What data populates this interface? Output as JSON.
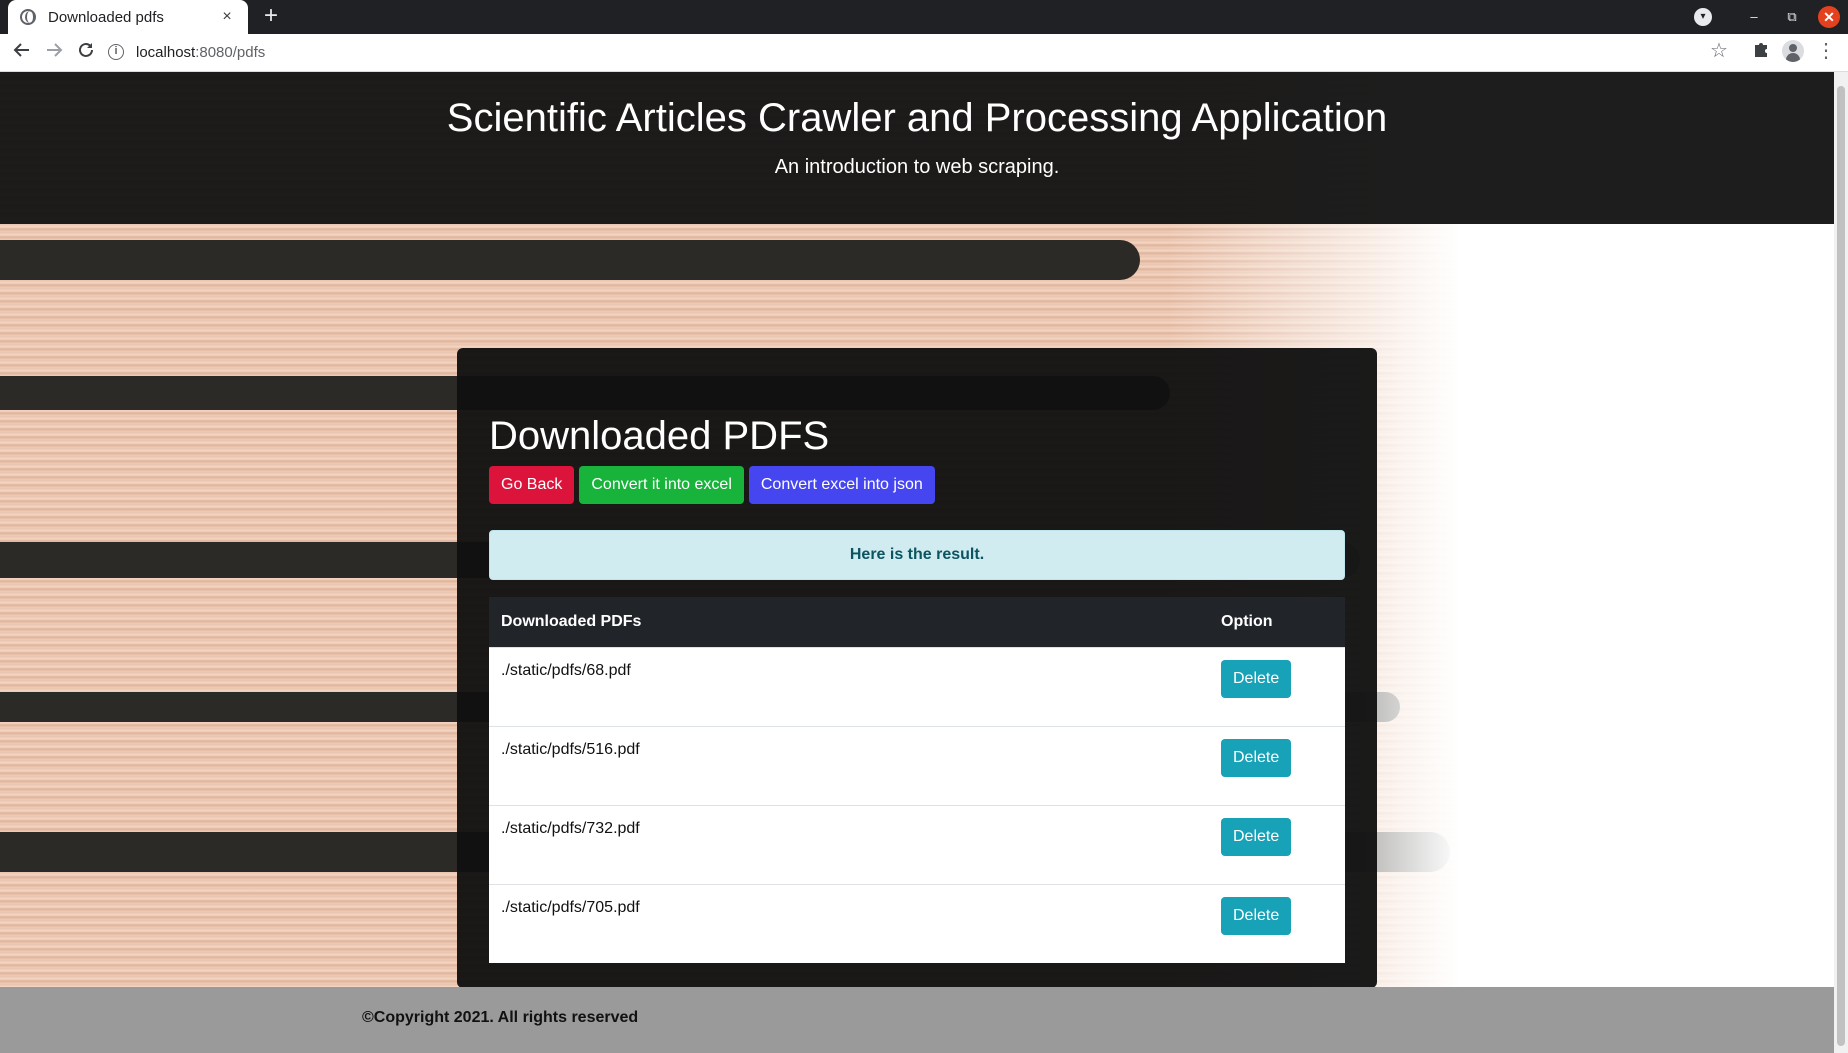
{
  "browser": {
    "tab_title": "Downloaded pdfs",
    "tab_close": "×",
    "new_tab": "+",
    "url_host": "localhost",
    "url_path": ":8080/pdfs",
    "win_minimize": "–",
    "win_restore": "⧉",
    "win_close": "✕"
  },
  "header": {
    "title": "Scientific Articles Crawler and Processing Application",
    "subtitle": "An introduction to web scraping."
  },
  "main": {
    "heading": "Downloaded PDFS",
    "buttons": {
      "go_back": "Go Back",
      "convert_excel": "Convert it into excel",
      "convert_json": "Convert excel into json"
    },
    "alert": "Here is the result.",
    "table": {
      "col_file": "Downloaded PDFs",
      "col_option": "Option",
      "delete_label": "Delete",
      "rows": [
        {
          "file": "./static/pdfs/68.pdf"
        },
        {
          "file": "./static/pdfs/516.pdf"
        },
        {
          "file": "./static/pdfs/732.pdf"
        },
        {
          "file": "./static/pdfs/705.pdf"
        }
      ]
    }
  },
  "footer": {
    "copyright": "©Copyright 2021. All rights reserved"
  },
  "colors": {
    "danger": "#dc143c",
    "success": "#17b33a",
    "primary": "#4646f0",
    "info": "#17a2b8",
    "alert_bg": "#d1ecf1"
  },
  "icons": {
    "favicon": "globe-icon",
    "back": "arrow-left-icon",
    "forward": "arrow-right-icon",
    "reload": "reload-icon",
    "info": "info-icon",
    "bookmark": "star-icon",
    "extensions": "puzzle-icon",
    "profile": "avatar-icon",
    "menu": "kebab-menu-icon"
  }
}
